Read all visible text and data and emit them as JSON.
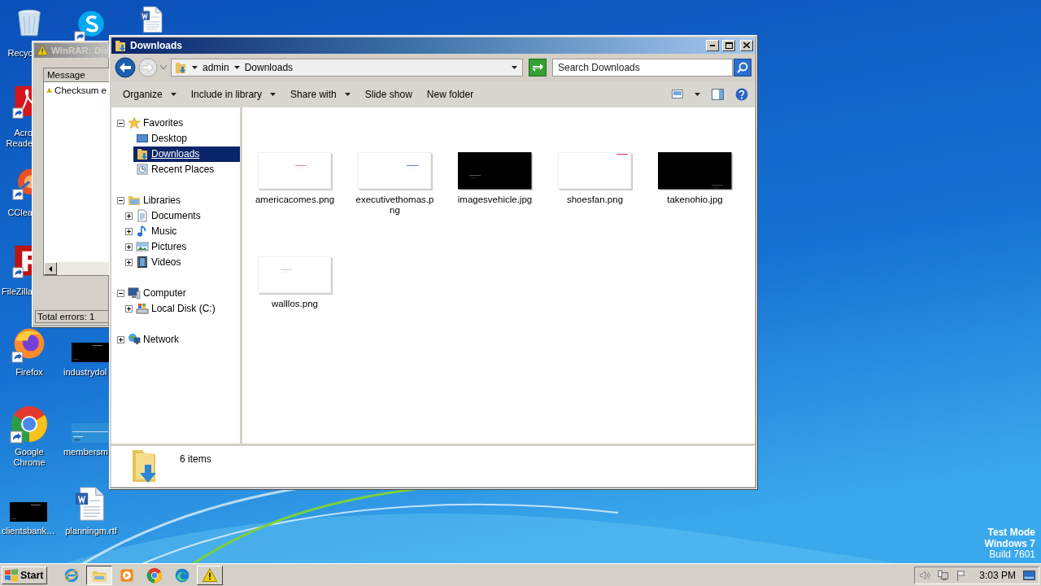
{
  "desktop": {
    "icons": [
      {
        "kind": "recycle-bin",
        "shortcut": false,
        "label": [
          "Recyc"
        ]
      },
      {
        "kind": "skype",
        "shortcut": true
      },
      {
        "kind": "word-document",
        "shortcut": false
      },
      {
        "kind": "acrobat",
        "shortcut": true,
        "label": [
          "Acro",
          "Reade"
        ]
      },
      {
        "kind": "ccleaner",
        "shortcut": true,
        "label": [
          "CClea"
        ]
      },
      {
        "kind": "filezilla",
        "shortcut": true,
        "label": [
          "FileZilla"
        ]
      },
      {
        "kind": "firefox",
        "shortcut": true,
        "label": [
          "Firefox"
        ]
      },
      {
        "kind": "dark-image",
        "label": [
          "industrydol"
        ]
      },
      {
        "kind": "chrome",
        "shortcut": true,
        "label": [
          "Google",
          "Chrome"
        ]
      },
      {
        "kind": "light-image",
        "label": [
          "membersm"
        ]
      },
      {
        "kind": "dark-image",
        "label": [
          "clientsbank…"
        ]
      },
      {
        "kind": "word-document",
        "shortcut": false,
        "label": [
          "planningm.rtf"
        ]
      }
    ]
  },
  "winrar_window": {
    "title": "WinRAR: Dia",
    "columns": [
      "Message"
    ],
    "rows": [
      {
        "message": "Checksum e"
      }
    ],
    "status": "Total errors: 1"
  },
  "explorer_window": {
    "title": "Downloads",
    "breadcrumb": [
      "admin",
      "Downloads"
    ],
    "search": {
      "placeholder": "Search Downloads"
    },
    "toolbar": [
      {
        "label": "Organize",
        "dropdown": true
      },
      {
        "label": "Include in library",
        "dropdown": true
      },
      {
        "label": "Share with",
        "dropdown": true
      },
      {
        "label": "Slide show",
        "dropdown": false
      },
      {
        "label": "New folder",
        "dropdown": false
      }
    ],
    "nav": [
      {
        "label": "Favorites",
        "kind": "favorites",
        "expanded": true,
        "selected": false,
        "children": [
          {
            "label": "Desktop",
            "kind": "desktop",
            "selected": false
          },
          {
            "label": "Downloads",
            "kind": "downloads",
            "selected": true
          },
          {
            "label": "Recent Places",
            "kind": "recent",
            "selected": false
          }
        ]
      },
      {
        "label": "Libraries",
        "kind": "libraries",
        "expanded": true,
        "selected": false,
        "children": [
          {
            "label": "Documents",
            "kind": "documents",
            "expanded": false,
            "selected": false
          },
          {
            "label": "Music",
            "kind": "music",
            "expanded": false,
            "selected": false
          },
          {
            "label": "Pictures",
            "kind": "pictures",
            "expanded": false,
            "selected": false
          },
          {
            "label": "Videos",
            "kind": "videos",
            "expanded": false,
            "selected": false
          }
        ]
      },
      {
        "label": "Computer",
        "kind": "computer",
        "expanded": true,
        "selected": false,
        "children": [
          {
            "label": "Local Disk (C:)",
            "kind": "disk",
            "expanded": false,
            "selected": false
          }
        ]
      },
      {
        "label": "Network",
        "kind": "network",
        "expanded": false,
        "selected": false
      }
    ],
    "files": [
      {
        "name": "americacomes.png",
        "kind": "light"
      },
      {
        "name": "executivethomas.png",
        "kind": "light"
      },
      {
        "name": "imagesvehicle.jpg",
        "kind": "dark"
      },
      {
        "name": "shoesfan.png",
        "kind": "light"
      },
      {
        "name": "takenohio.jpg",
        "kind": "dark"
      },
      {
        "name": "walllos.png",
        "kind": "light"
      }
    ],
    "status": "6 items"
  },
  "os_notice": [
    "Test Mode",
    "Windows 7",
    "Build 7601"
  ],
  "taskbar": {
    "start": "Start",
    "apps": [
      {
        "kind": "internet-explorer",
        "running": false,
        "selected": false
      },
      {
        "kind": "explorer",
        "running": true,
        "selected": true
      },
      {
        "kind": "media-player",
        "running": false,
        "selected": false
      },
      {
        "kind": "chrome",
        "running": false,
        "selected": false
      },
      {
        "kind": "edge",
        "running": false,
        "selected": false
      },
      {
        "kind": "warning",
        "running": true,
        "selected": false
      }
    ],
    "clock": "3:03 PM"
  }
}
